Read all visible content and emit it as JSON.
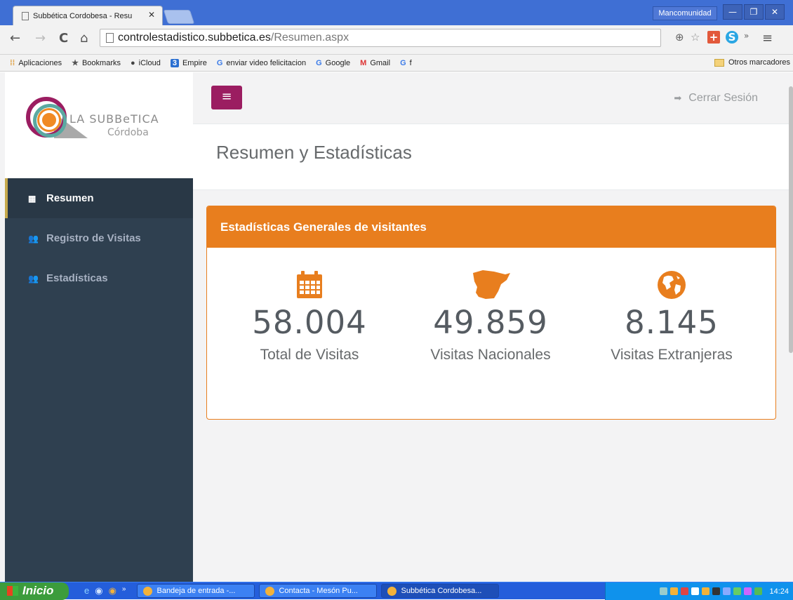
{
  "browser": {
    "tab_title": "Subbética Cordobesa - Resu",
    "tab_close": "✕",
    "window_user": "Mancomunidad",
    "url_host": "controlestadistico.subbetica.es",
    "url_path": "/Resumen.aspx",
    "bookmarks": [
      {
        "icon": "apps-icon",
        "label": "Aplicaciones"
      },
      {
        "icon": "star-icon",
        "label": "Bookmarks"
      },
      {
        "icon": "apple-icon",
        "label": "iCloud"
      },
      {
        "icon": "empire-icon",
        "label": "Empire"
      },
      {
        "icon": "google-icon",
        "label": "enviar video felicitacion"
      },
      {
        "icon": "google-icon",
        "label": "Google"
      },
      {
        "icon": "gmail-icon",
        "label": "Gmail"
      },
      {
        "icon": "google-icon",
        "label": "f"
      }
    ],
    "other_bookmarks": "Otros marcadores"
  },
  "brand": {
    "name": "LA SUBBeTICA",
    "sub": "Córdoba",
    "colors": {
      "magenta": "#9b1d61",
      "teal": "#5aa9a1",
      "orange": "#f08a24"
    }
  },
  "sidebar": {
    "items": [
      {
        "label": "Resumen",
        "icon": "grid-icon",
        "active": true
      },
      {
        "label": "Registro de Visitas",
        "icon": "users-icon",
        "active": false
      },
      {
        "label": "Estadísticas",
        "icon": "users-icon",
        "active": false
      }
    ]
  },
  "topbar": {
    "logout_label": "Cerrar Sesión"
  },
  "page": {
    "title": "Resumen y Estadísticas"
  },
  "panel": {
    "title": "Estadísticas Generales de visitantes",
    "accent": "#e87e1e",
    "stats": [
      {
        "icon": "calendar-icon",
        "value": "58.004",
        "label": "Total de Visitas"
      },
      {
        "icon": "spain-map-icon",
        "value": "49.859",
        "label": "Visitas Nacionales"
      },
      {
        "icon": "globe-icon",
        "value": "8.145",
        "label": "Visitas Extranjeras"
      }
    ]
  },
  "taskbar": {
    "start_label": "Inicio",
    "tasks": [
      {
        "label": "Bandeja de entrada -...",
        "active": false
      },
      {
        "label": "Contacta - Mesón Pu...",
        "active": false
      },
      {
        "label": "Subbética Cordobesa...",
        "active": true
      }
    ],
    "clock": "14:24"
  }
}
